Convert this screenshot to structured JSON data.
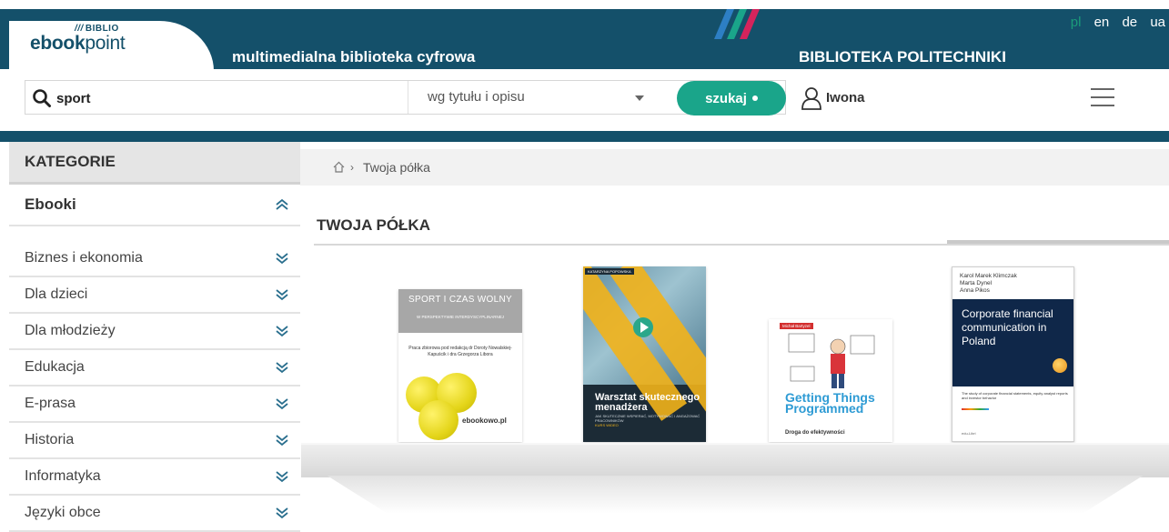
{
  "header": {
    "logo_top": "BIBLIO",
    "logo_slashes": "///",
    "logo_main_bold": "ebook",
    "logo_main_light": "point",
    "tagline": "multimedialna biblioteka cyfrowa",
    "library_name": "BIBLIOTEKA POLITECHNIKI",
    "languages": [
      "pl",
      "en",
      "de",
      "ua"
    ],
    "active_language": "pl",
    "stripe_colors": [
      "#2d7fc4",
      "#1aa58a",
      "#d4245c"
    ]
  },
  "search": {
    "query": "sport",
    "mode": "wg tytułu i opisu",
    "button_label": "szukaj",
    "icon": "search-icon"
  },
  "user": {
    "name": "Iwona",
    "icon": "user-icon"
  },
  "sidebar": {
    "header": "KATEGORIE",
    "section": "Ebooki",
    "categories": [
      "Biznes i ekonomia",
      "Dla dzieci",
      "Dla młodzieży",
      "Edukacja",
      "E-prasa",
      "Historia",
      "Informatyka",
      "Języki obce"
    ]
  },
  "breadcrumb": {
    "home_icon": "home-icon",
    "current": "Twoja półka"
  },
  "shelf": {
    "title": "TWOJA PÓŁKA",
    "books": [
      {
        "title": "SPORT I CZAS WOLNY",
        "subtitle": "W PERSPEKTYWIE INTERDYSCYPLINARNEJ",
        "editors": "Praca zbiorowa pod redakcją dr Doroty Nowalskiej-Kapuścik i dra Grzegorza Libora",
        "brand": "ebookowo.pl"
      },
      {
        "author": "KATARZYNA POPOWSKA",
        "title": "Warsztat skutecznego menadżera",
        "subtitle": "JAK SKUTECZNIE WSPIERAĆ, MOTYWOWAĆ I ANGAŻOWAĆ PRACOWNIKÓW",
        "format": "KURS WIDEO"
      },
      {
        "author": "Michał Bartyzel",
        "title": "Getting Things Programmed",
        "subtitle": "Droga do efektywności"
      },
      {
        "authors": [
          "Karol Marek Klimczak",
          "Marta Dynel",
          "Anna Pikos"
        ],
        "title": "Corporate financial communication in Poland",
        "subtitle": "The study of corporate financial statements, equity analyst reports and investor behavior",
        "publisher": "edu-Libri"
      }
    ]
  },
  "colors": {
    "brand": "#14506a",
    "accent": "#1aa58a"
  }
}
